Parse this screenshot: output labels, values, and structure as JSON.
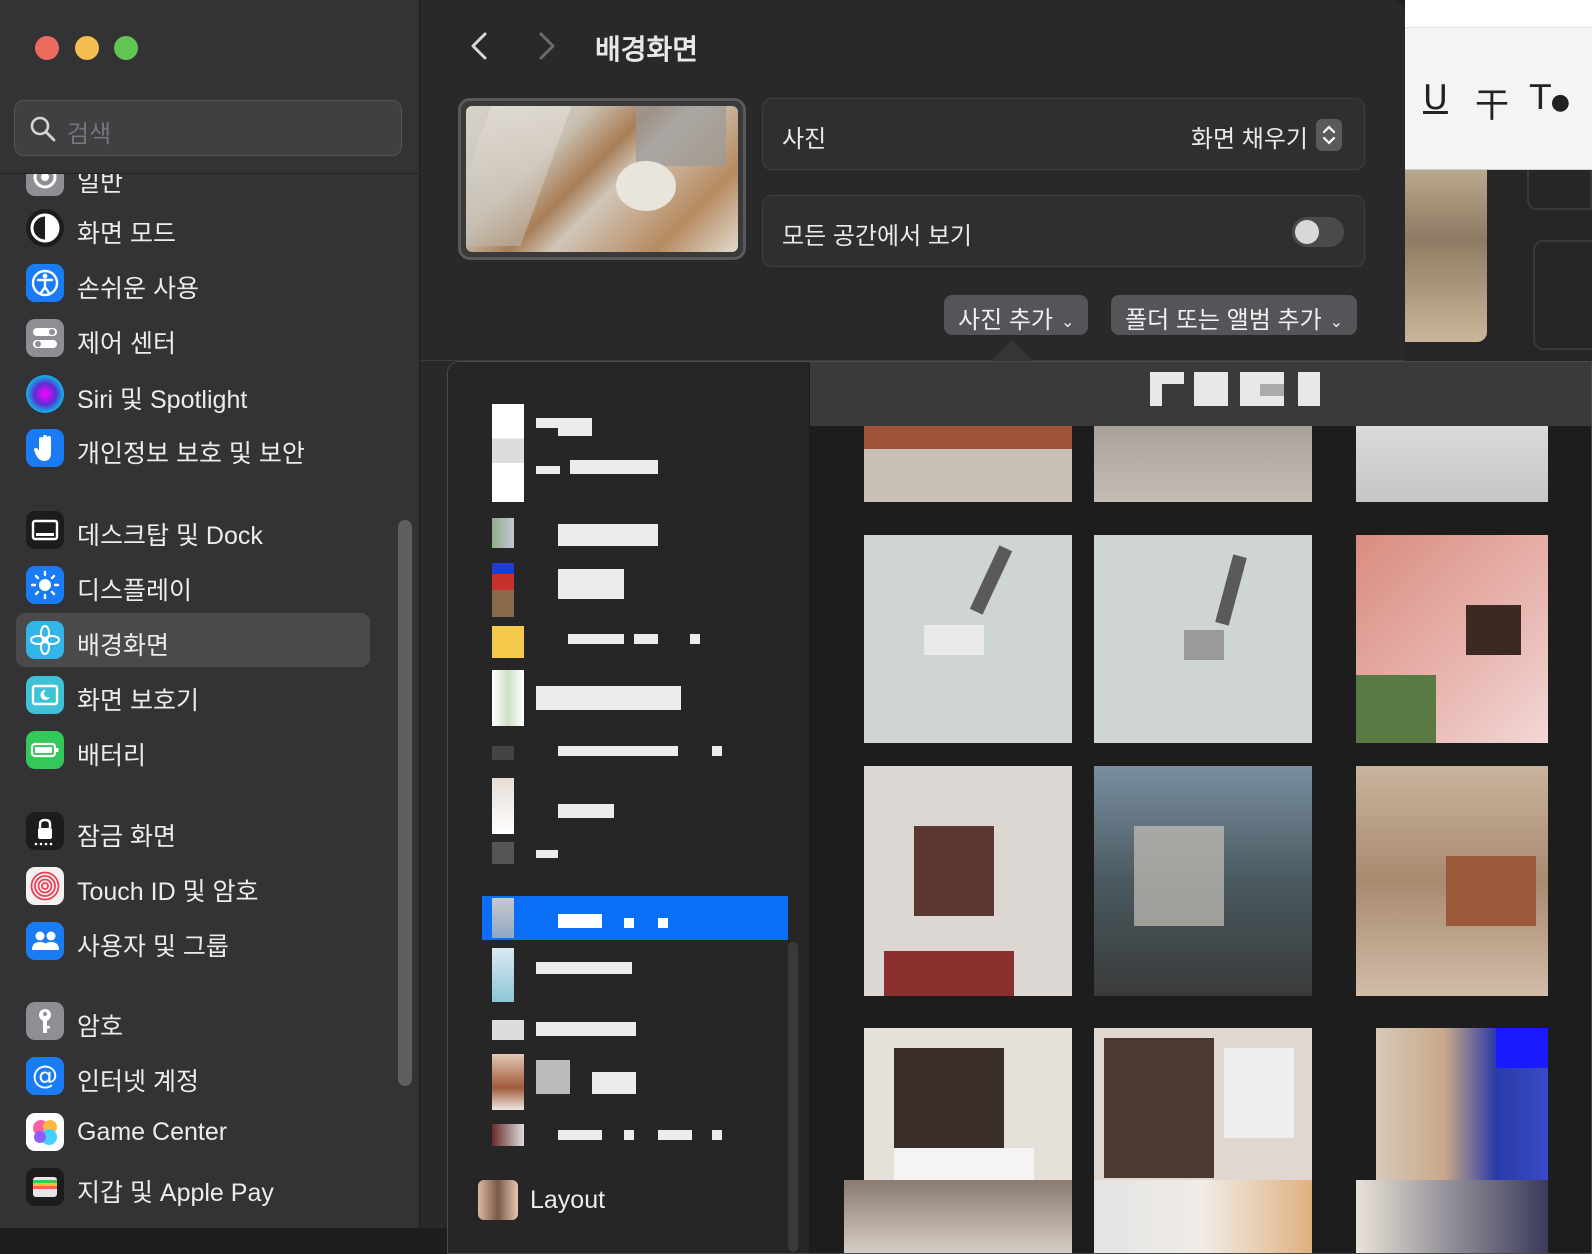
{
  "sidebar": {
    "search_placeholder": "검색",
    "items": [
      {
        "label": "일반",
        "icon": "gear-icon",
        "color": "#8e8e93"
      },
      {
        "label": "화면 모드",
        "icon": "appearance-icon",
        "color": "#1c1c1e"
      },
      {
        "label": "손쉬운 사용",
        "icon": "accessibility-icon",
        "color": "#1a7cf5"
      },
      {
        "label": "제어 센터",
        "icon": "control-center-icon",
        "color": "#8e8e93"
      },
      {
        "label": "Siri 및 Spotlight",
        "icon": "siri-icon",
        "color": "#6b3bd6"
      },
      {
        "label": "개인정보 보호 및 보안",
        "icon": "hand-icon",
        "color": "#1a7cf5"
      },
      {
        "label": "데스크탑 및 Dock",
        "icon": "dock-icon",
        "color": "#1c1c1e"
      },
      {
        "label": "디스플레이",
        "icon": "sun-icon",
        "color": "#1a7cf5"
      },
      {
        "label": "배경화면",
        "icon": "flower-icon",
        "color": "#33b5e8",
        "selected": true
      },
      {
        "label": "화면 보호기",
        "icon": "screensaver-icon",
        "color": "#3fc1d6"
      },
      {
        "label": "배터리",
        "icon": "battery-icon",
        "color": "#34c759"
      },
      {
        "label": "잠금 화면",
        "icon": "lock-icon",
        "color": "#1c1c1e"
      },
      {
        "label": "Touch ID 및 암호",
        "icon": "fingerprint-icon",
        "color": "#f2f2f2"
      },
      {
        "label": "사용자 및 그룹",
        "icon": "users-icon",
        "color": "#1a7cf5"
      },
      {
        "label": "암호",
        "icon": "key-icon",
        "color": "#8e8e93"
      },
      {
        "label": "인터넷 계정",
        "icon": "at-icon",
        "color": "#1a7cf5"
      },
      {
        "label": "Game Center",
        "icon": "game-center-icon",
        "color": "#ffffff"
      },
      {
        "label": "지갑 및 Apple Pay",
        "icon": "wallet-icon",
        "color": "#1c1c1e"
      }
    ]
  },
  "content": {
    "title": "배경화면",
    "photo_label": "사진",
    "fill_mode": "화면 채우기",
    "all_spaces_label": "모든 공간에서 보기",
    "all_spaces_on": false,
    "add_photo_label": "사진 추가",
    "add_folder_label": "폴더 또는 앨범 추가"
  },
  "popover": {
    "layout_label": "Layout"
  },
  "bg_app": {
    "underline_glyph": "U",
    "strike_glyph": "干",
    "text_glyph": "T"
  },
  "colors": {
    "accent": "#0b6ef6",
    "close": "#ed6a5e",
    "minimize": "#f5bf4f",
    "zoom": "#61c554"
  }
}
